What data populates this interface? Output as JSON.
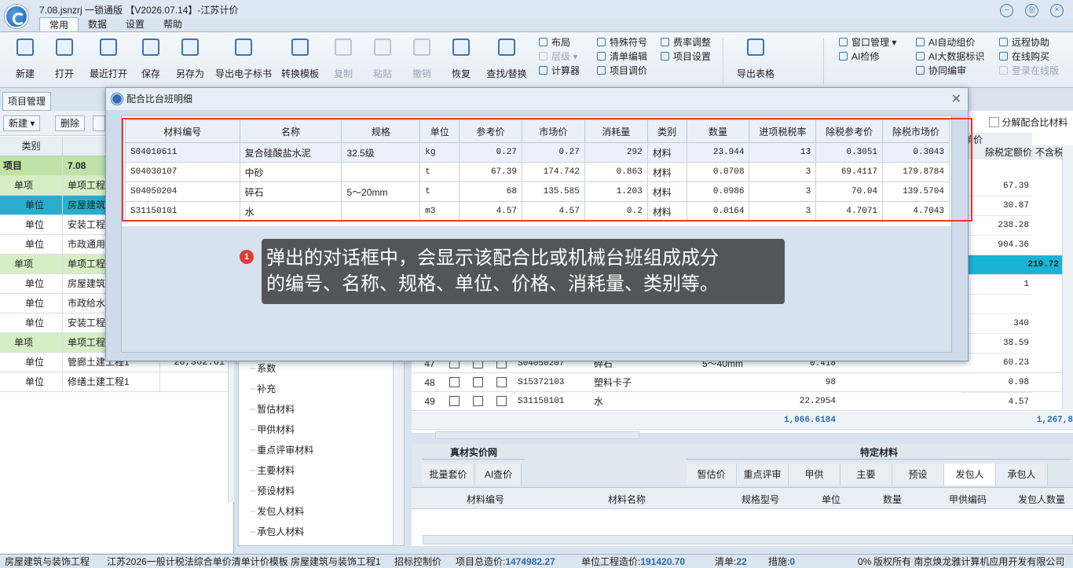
{
  "window": {
    "title": "7.08.jsnzrj 一锁通版 【V2026.07.14】-江苏计价"
  },
  "menu_tabs": [
    "常用",
    "数据",
    "设置",
    "帮助"
  ],
  "ribbon": {
    "big_buttons": [
      "新建",
      "打开",
      "最近打开",
      "保存",
      "另存为",
      "导出电子标书",
      "转换模板",
      "复制",
      "粘贴",
      "撤销",
      "恢复",
      "查找/替换"
    ],
    "group1": [
      "布局",
      "层级",
      "计算器"
    ],
    "group2": [
      "特殊符号",
      "清单编辑",
      "项目调价"
    ],
    "group3": [
      "费率调整",
      "项目设置"
    ],
    "export": "导出表格",
    "group4": [
      "窗口管理",
      "AI检修"
    ],
    "group5": [
      "AI自动组价",
      "AI大数据标识",
      "协同编审"
    ],
    "group6": [
      "远程协助",
      "在线购买",
      "登录在线版"
    ]
  },
  "left_panel": {
    "tab": "项目管理",
    "tools": [
      "新建",
      "删除"
    ],
    "headers": [
      "类别",
      "名称"
    ],
    "rows": [
      {
        "type": "项目",
        "name": "7.08",
        "value": ""
      },
      {
        "type": "单项",
        "name": "单项工程",
        "value": ""
      },
      {
        "type": "单位",
        "name": "房屋建筑",
        "value": ""
      },
      {
        "type": "单位",
        "name": "安装工程",
        "value": ""
      },
      {
        "type": "单位",
        "name": "市政通用",
        "value": ""
      },
      {
        "type": "单项",
        "name": "单项工程",
        "value": ""
      },
      {
        "type": "单位",
        "name": "房屋建筑",
        "value": ""
      },
      {
        "type": "单位",
        "name": "市政给水",
        "value": ""
      },
      {
        "type": "单位",
        "name": "安装工程",
        "value": ""
      },
      {
        "type": "单项",
        "name": "单项工程",
        "value": ""
      },
      {
        "type": "单位",
        "name": "管廊土建工程1",
        "value": "28,362.61"
      },
      {
        "type": "单位",
        "name": "修缮土建工程1",
        "value": ""
      }
    ]
  },
  "middle_tree": [
    "系数",
    "补充",
    "暂估材料",
    "甲供材料",
    "重点评审材料",
    "主要材料",
    "预设材料",
    "发包人材料",
    "承包人材料"
  ],
  "right_grid": {
    "top_option": "分解配合比材料",
    "col_unit": "单价",
    "col_a": "除税定额价",
    "col_b": "不含税",
    "right_values": [
      "67.39",
      "30.87",
      "238.28",
      "904.36",
      "219.72",
      "1",
      "",
      "340",
      "38.59",
      "60.23",
      "0.98",
      "4.57"
    ],
    "rows": [
      {
        "no": "47",
        "code": "S04050207",
        "name": "碎石",
        "spec": "5～40mm",
        "qty": "0.418"
      },
      {
        "no": "48",
        "code": "S15372103",
        "name": "塑料卡子",
        "spec": "",
        "qty": "98"
      },
      {
        "no": "49",
        "code": "S31150101",
        "name": "水",
        "spec": "",
        "qty": "22.2954"
      }
    ],
    "total_qty": "1,066.6184",
    "total_right": "1,267,8"
  },
  "bottom": {
    "left_title": "真材实价网",
    "left_buttons": [
      "批量套价",
      "AI查价"
    ],
    "right_title": "特定材料",
    "right_tabs": [
      "暂估价",
      "重点评审",
      "甲供",
      "主要",
      "预设",
      "发包人",
      "承包人"
    ],
    "headers": [
      "材料编号",
      "材料名称",
      "规格型号",
      "单位",
      "数量",
      "甲供编码",
      "发包人数量"
    ]
  },
  "status": {
    "items": [
      "房屋建筑与装饰工程",
      "江苏2026一般计税法综合单价清单计价模板",
      "房屋建筑与装饰工程1",
      "招标控制价"
    ],
    "total_label": "项目总造价:",
    "total_value": "1474982.27",
    "unit_label": "单位工程造价:",
    "unit_value": "191420.70",
    "list_label": "清单:",
    "list_value": "22",
    "measure_label": "措施:",
    "measure_value": "0",
    "progress": "0%",
    "copyright": "版权所有 南京焕龙雅计算机应用开发有限公司"
  },
  "dialog": {
    "title": "配合比台班明细",
    "headers": [
      "材料编号",
      "名称",
      "规格",
      "单位",
      "参考价",
      "市场价",
      "消耗量",
      "类别",
      "数量",
      "进项税税率",
      "除税参考价",
      "除税市场价"
    ],
    "rows": [
      [
        "S04010611",
        "复合硅酸盐水泥",
        "32.5级",
        "kg",
        "0.27",
        "0.27",
        "292",
        "材料",
        "23.944",
        "13",
        "0.3051",
        "0.3043"
      ],
      [
        "S04030107",
        "中砂",
        "",
        "t",
        "67.39",
        "174.742",
        "0.863",
        "材料",
        "0.0708",
        "3",
        "69.4117",
        "179.8784"
      ],
      [
        "S04050204",
        "碎石",
        "5～20mm",
        "t",
        "68",
        "135.585",
        "1.203",
        "材料",
        "0.0986",
        "3",
        "70.04",
        "139.5704"
      ],
      [
        "S31150101",
        "水",
        "",
        "m3",
        "4.57",
        "4.57",
        "0.2",
        "材料",
        "0.0164",
        "3",
        "4.7071",
        "4.7043"
      ]
    ]
  },
  "tooltip": {
    "badge": "1",
    "line1": "弹出的对话框中，会显示该配合比或机械台班组成成分",
    "line2": "的编号、名称、规格、单位、价格、消耗量、类别等。"
  }
}
